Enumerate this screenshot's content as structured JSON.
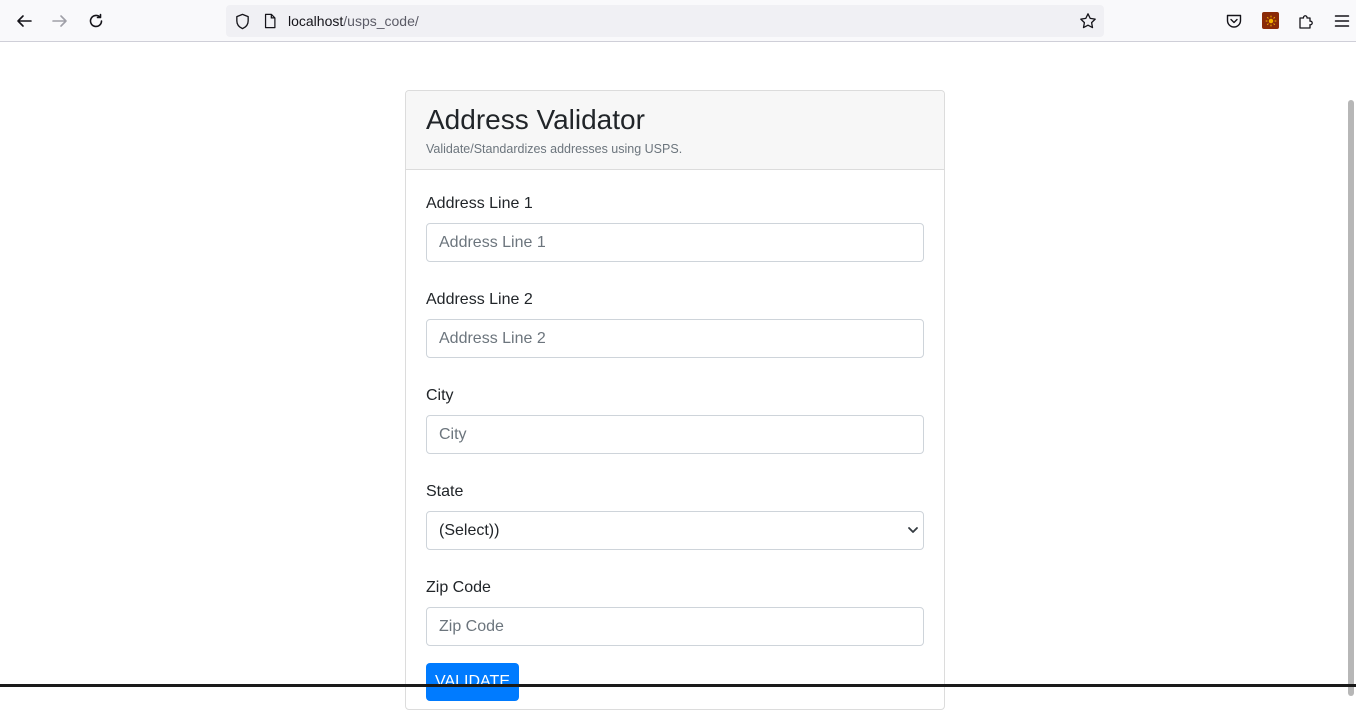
{
  "browser": {
    "url_host": "localhost",
    "url_path": "/usps_code/"
  },
  "card": {
    "title": "Address Validator",
    "subtitle": "Validate/Standardizes addresses using USPS."
  },
  "form": {
    "address1": {
      "label": "Address Line 1",
      "placeholder": "Address Line 1"
    },
    "address2": {
      "label": "Address Line 2",
      "placeholder": "Address Line 2"
    },
    "city": {
      "label": "City",
      "placeholder": "City"
    },
    "state": {
      "label": "State",
      "selected": "(Select))"
    },
    "zip": {
      "label": "Zip Code",
      "placeholder": "Zip Code"
    },
    "submit_label": "VALIDATE"
  },
  "colors": {
    "primary": "#007bff",
    "header_bg": "#f7f7f7",
    "border": "#dcdcdc"
  }
}
